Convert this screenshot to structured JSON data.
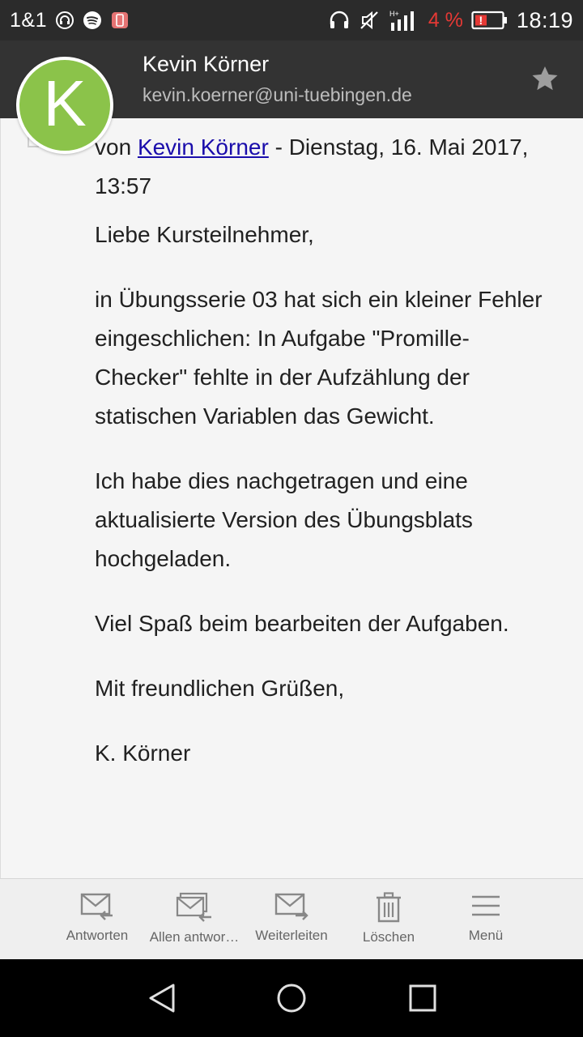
{
  "status_bar": {
    "carrier": "1&1",
    "left_icons": [
      "headset-icon",
      "spotify-icon",
      "app-notification-icon"
    ],
    "right_icons": [
      "headphones-icon",
      "muted-icon",
      "signal-icon",
      "battery-icon"
    ],
    "network_type": "H+",
    "battery_percent": "4 %",
    "battery_color": "#e53935",
    "time": "18:19"
  },
  "header": {
    "sender_name": "Kevin Körner",
    "sender_email": "kevin.koerner@uni-tuebingen.de",
    "avatar_letter": "K",
    "avatar_color": "#8bc34a",
    "star_icon": "star-icon"
  },
  "message": {
    "from_prefix": "von ",
    "from_link": "Kevin Körner",
    "date_text": " - Dienstag, 16. Mai 2017, 13:57",
    "greeting": "Liebe Kursteilnehmer,",
    "paragraph_1": "in Übungsserie 03 hat sich ein kleiner Fehler eingeschlichen: In Aufgabe \"Promille-Checker\" fehlte in der Aufzählung der statischen Variablen das Gewicht.",
    "paragraph_2": "Ich habe dies nachgetragen und eine aktualisierte Version des Übungsblats hochgeladen.",
    "paragraph_3": "Viel Spaß beim bearbeiten der Aufgaben.",
    "closing": "Mit freundlichen Grüßen,",
    "signature": "K. Körner",
    "link_color": "#1a0dab"
  },
  "actions": [
    {
      "label": "Antworten",
      "icon": "reply-icon"
    },
    {
      "label": "Allen antwor…",
      "icon": "reply-all-icon"
    },
    {
      "label": "Weiterleiten",
      "icon": "forward-icon"
    },
    {
      "label": "Löschen",
      "icon": "trash-icon"
    },
    {
      "label": "Menü",
      "icon": "menu-icon"
    }
  ],
  "nav_bar": {
    "buttons": [
      "back-icon",
      "home-icon",
      "recents-icon"
    ]
  }
}
